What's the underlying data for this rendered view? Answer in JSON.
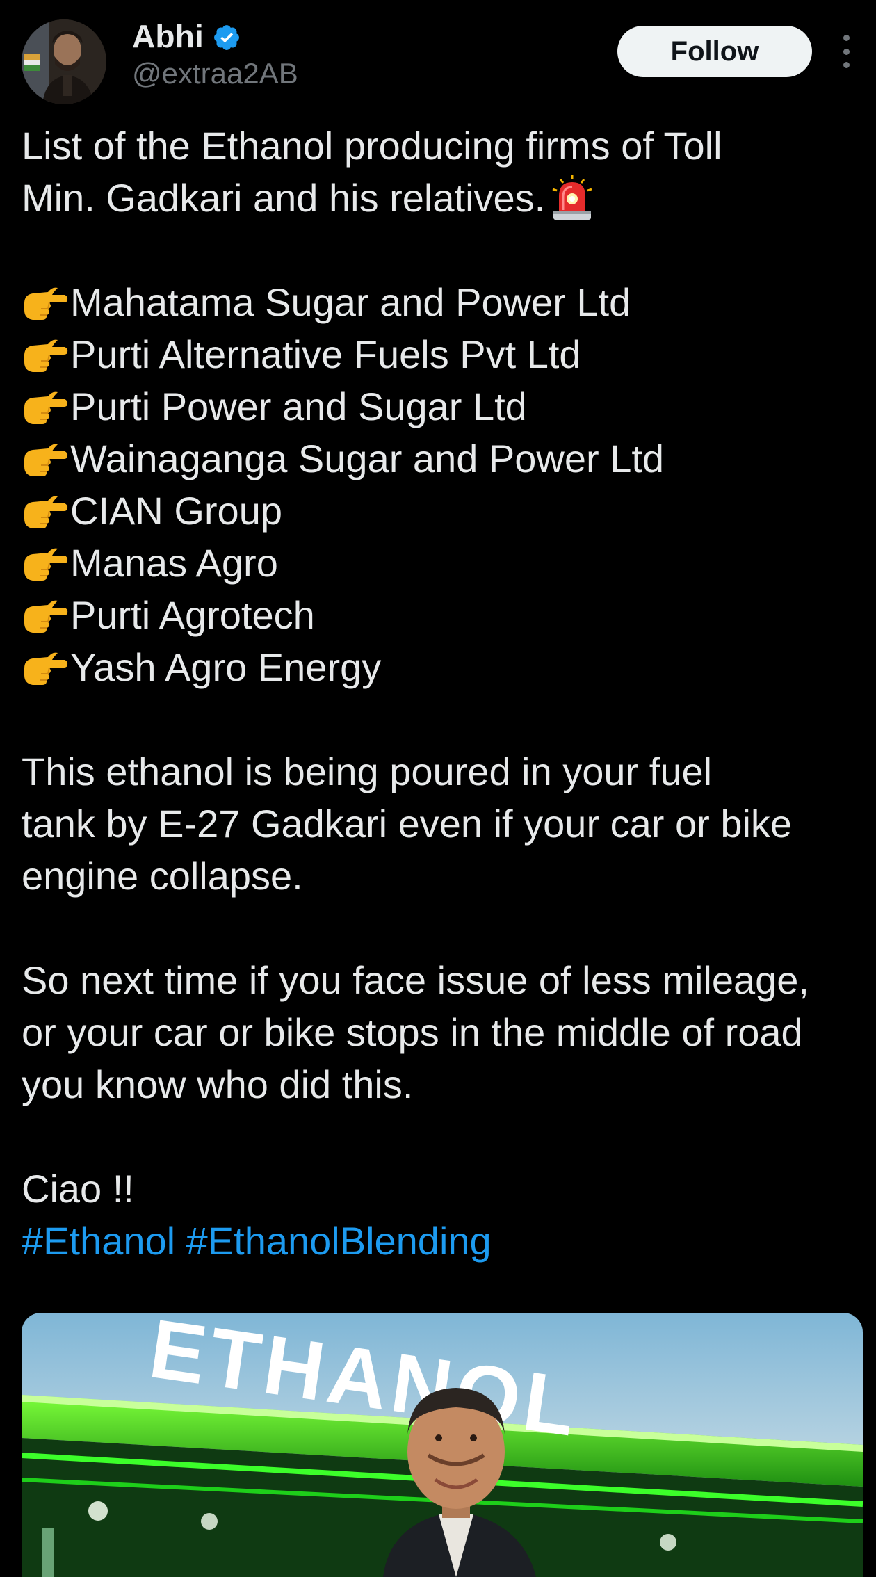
{
  "author": {
    "display_name": "Abhi",
    "handle": "@extraa2AB",
    "verified": true,
    "verified_color": "#1d9bf0",
    "avatar_icon": "profile-photo"
  },
  "actions": {
    "follow_label": "Follow",
    "more_icon": "more-vertical-icon"
  },
  "tweet": {
    "intro_line_1": "List of the Ethanol producing firms of Toll",
    "intro_line_2": "Min. Gadkari and his relatives.",
    "intro_emoji": "police-siren-emoji",
    "list_emoji": "pointing-right-emoji",
    "firms": [
      "Mahatama Sugar and Power Ltd",
      "Purti Alternative Fuels Pvt Ltd",
      "Purti Power and Sugar Ltd",
      "Wainaganga Sugar and Power Ltd",
      "CIAN Group",
      "Manas Agro",
      "Purti Agrotech",
      "Yash Agro Energy"
    ],
    "para2_line_1": "This ethanol is being poured in your fuel",
    "para2_line_2": "tank by E-27 Gadkari even if your car or bike",
    "para2_line_3": "engine collapse.",
    "para3_line_1": "So next time if you face issue of less mileage,",
    "para3_line_2": "or your car or bike stops in the middle of road",
    "para3_line_3": "you know who did this.",
    "signoff": "Ciao !!",
    "hashtags": [
      "#Ethanol",
      "#EthanolBlending"
    ],
    "hashtag_color": "#1d9bf0"
  },
  "media": {
    "headline_text": "ETHANOL",
    "description": "photo"
  }
}
